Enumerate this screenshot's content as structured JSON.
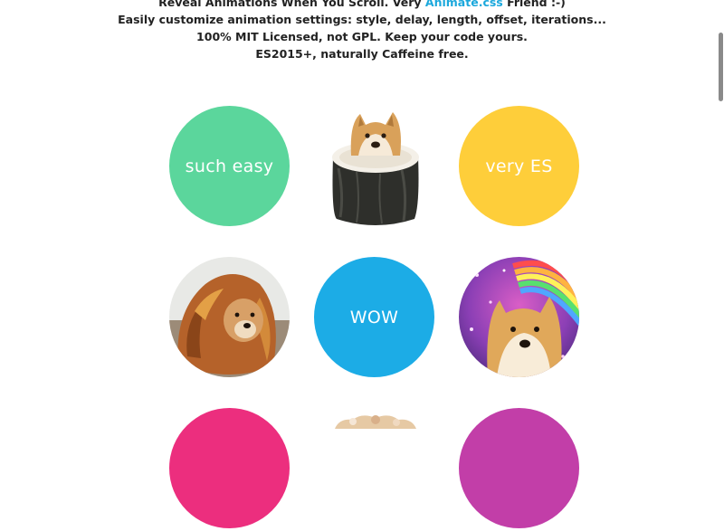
{
  "intro": {
    "line1_before": "Reveal Animations When You Scroll. Very ",
    "line1_link": "Animate.css",
    "line1_after": " Friend :-)",
    "line2": "Easily customize animation settings: style, delay, length, offset, iterations...",
    "line3": "100% MIT Licensed, not GPL. Keep your code yours.",
    "line4": "ES2015+, naturally Caffeine free."
  },
  "tiles": {
    "such_easy": "such easy",
    "very_es": "very ES",
    "wow": "WOW"
  },
  "colors": {
    "green": "#5bd69c",
    "yellow": "#fece3a",
    "blue": "#1cace6",
    "pink": "#ec2e7e",
    "purple": "#c23ea8",
    "link": "#1ba8dc"
  },
  "images": [
    "sushi-doge",
    "lion-doge",
    "rainbow-doge",
    "cookie-doge"
  ]
}
